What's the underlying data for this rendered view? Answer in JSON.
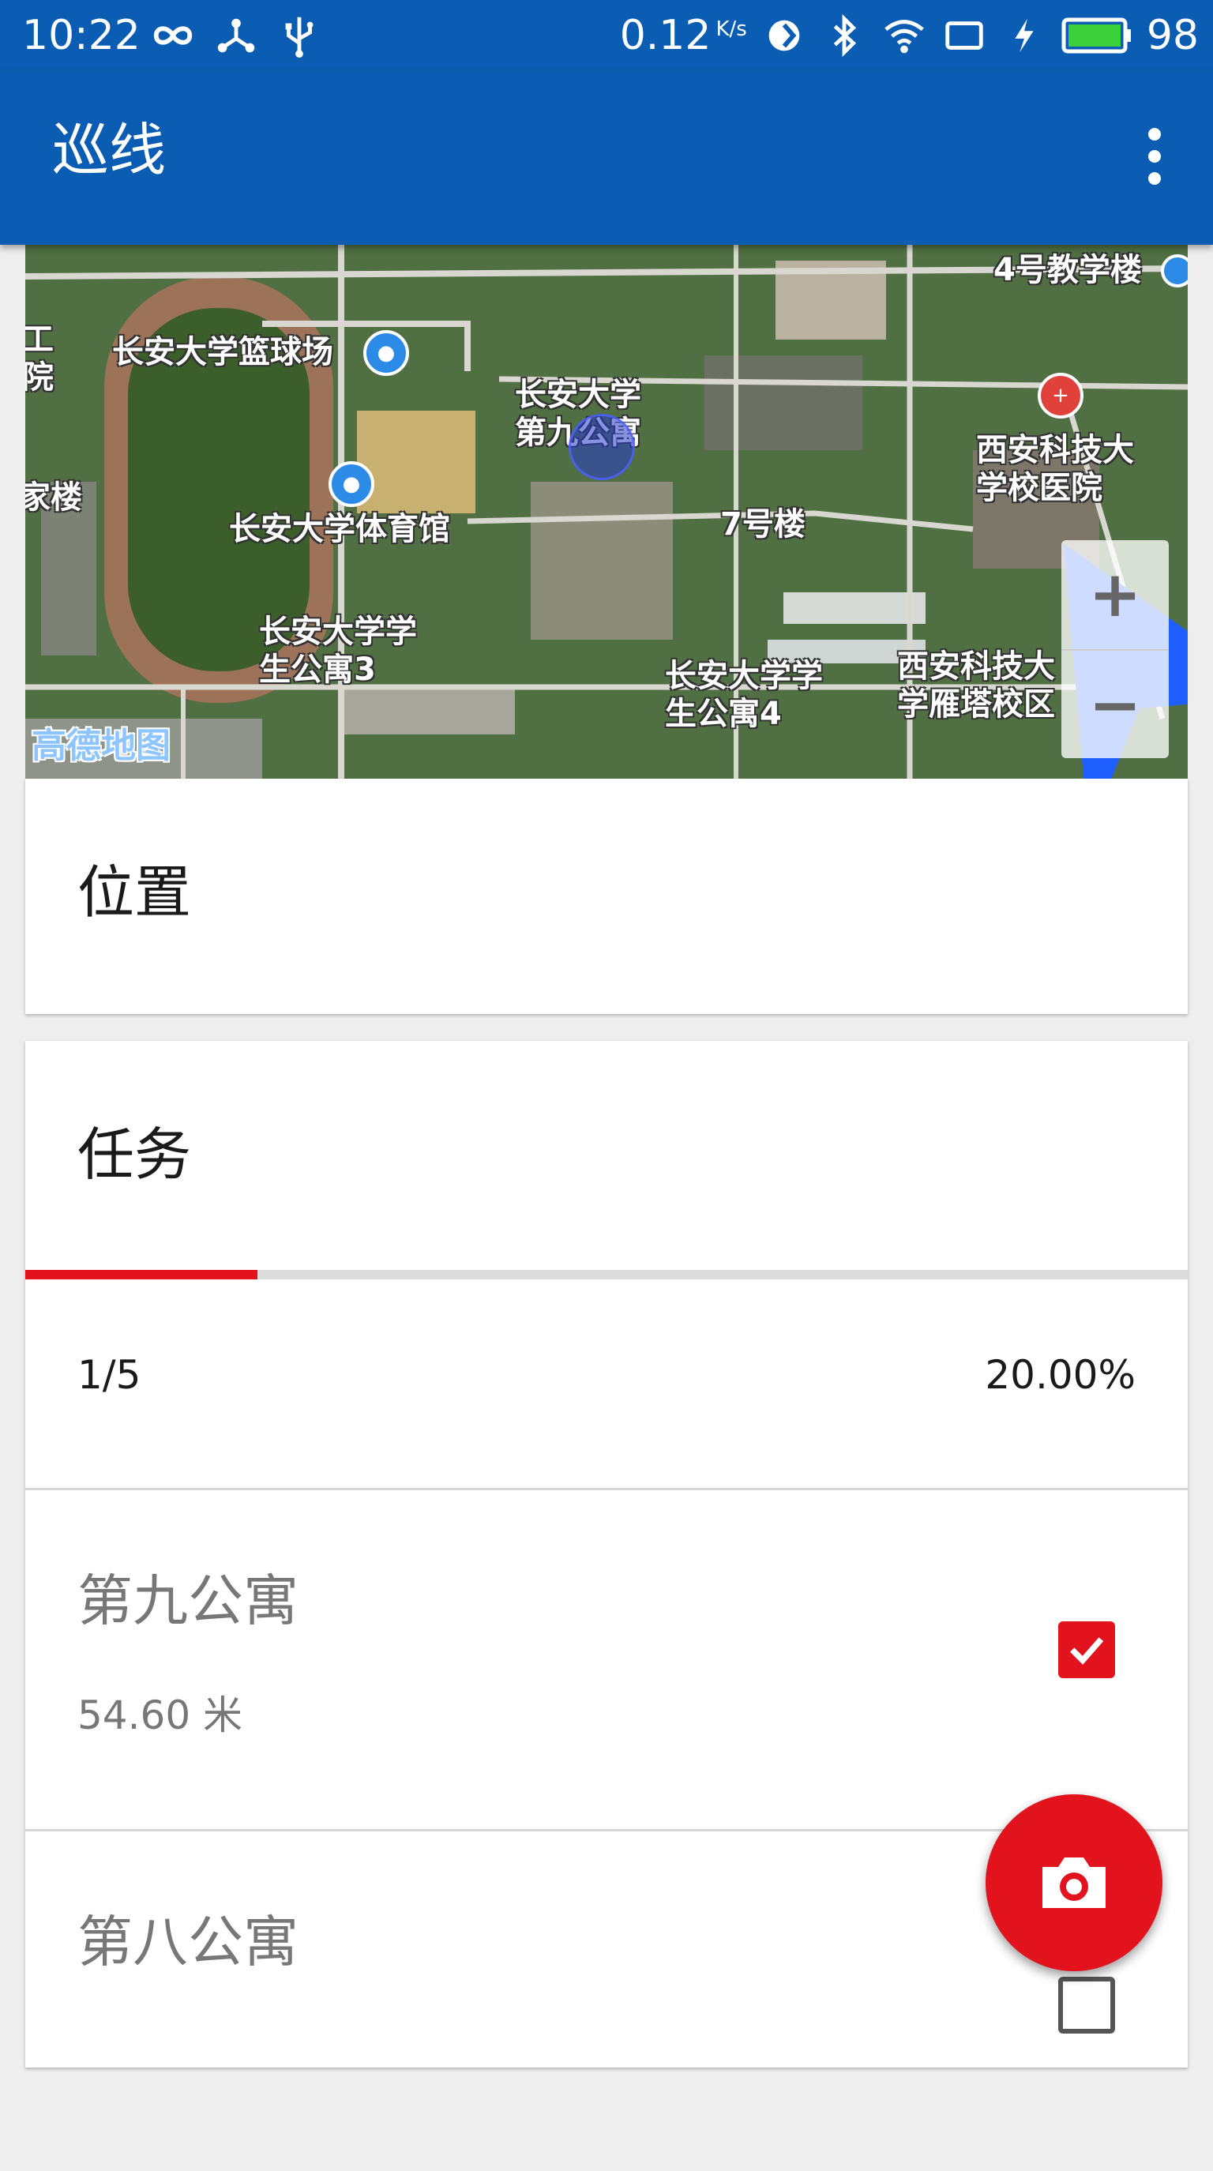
{
  "status_bar": {
    "time": "10:22",
    "net_speed": "0.12",
    "net_speed_unit": "K/s",
    "battery_level": "98",
    "icons": [
      "infinity-icon",
      "share-icon",
      "usb-icon",
      "sync-icon",
      "bluetooth-icon",
      "wifi-icon",
      "screen-icon",
      "charging-icon",
      "battery-icon"
    ]
  },
  "app_bar": {
    "title": "巡线",
    "menu_icon": "more-vert-icon"
  },
  "map": {
    "labels": {
      "no4_building": "4号教学楼",
      "partial_gong": "工\n院",
      "basketball": "长安大学篮球场",
      "apartment9": "长安大学\n第九公寓",
      "hospital": "西安科技大\n学校医院",
      "partial_lou": "家楼",
      "gym": "长安大学体育馆",
      "building7": "7号楼",
      "apartment3": "长安大学学\n生公寓3",
      "apartment4": "长安大学学\n生公寓4",
      "yanta_campus": "西安科技大\n学雁塔校区"
    },
    "logo": "高德地图",
    "zoom_in": "+",
    "zoom_out": "−"
  },
  "location_card": {
    "heading": "位置"
  },
  "task_card": {
    "heading": "任务",
    "progress_fraction": 0.2,
    "progress_count": "1/5",
    "progress_percent": "20.00%",
    "accent_color": "#e3131e",
    "items": [
      {
        "name": "第九公寓",
        "distance": "54.60 米",
        "checked": true
      },
      {
        "name": "第八公寓",
        "checked": false
      }
    ]
  },
  "fab": {
    "icon": "camera-icon"
  }
}
